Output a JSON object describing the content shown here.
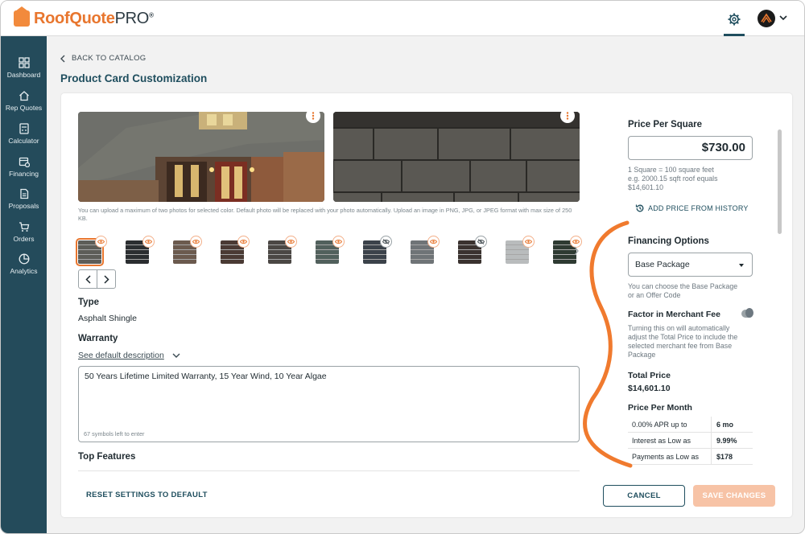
{
  "app": {
    "logo_main": "RoofQuote",
    "logo_pro": "PRO",
    "logo_reg": "®"
  },
  "sidebar": {
    "items": [
      {
        "label": "Dashboard",
        "icon": "dashboard-icon"
      },
      {
        "label": "Rep Quotes",
        "icon": "house-icon"
      },
      {
        "label": "Calculator",
        "icon": "calculator-icon"
      },
      {
        "label": "Financing",
        "icon": "calendar-money-icon"
      },
      {
        "label": "Proposals",
        "icon": "document-icon"
      },
      {
        "label": "Orders",
        "icon": "cart-icon"
      },
      {
        "label": "Analytics",
        "icon": "pie-chart-icon"
      }
    ]
  },
  "header": {
    "back_label": "BACK TO CATALOG",
    "title": "Product Card Customization"
  },
  "photos": {
    "note": "You can upload a maximum of two photos for selected color. Default photo will be replaced with your photo automatically. Upload an image in PNG, JPG, or JPEG format with max size of 250 KB."
  },
  "swatches": {
    "colors": [
      "#5d5d58",
      "#2b2e30",
      "#6b5a4e",
      "#4a3a34",
      "#4b4744",
      "#51605c",
      "#3b424a",
      "#6f7477",
      "#3a322f",
      "#b9bcbd",
      "#2e3a32"
    ],
    "visible": [
      true,
      true,
      true,
      true,
      true,
      true,
      false,
      true,
      false,
      true,
      true
    ],
    "selected_index": 0
  },
  "details": {
    "type_label": "Type",
    "type_value": "Asphalt Shingle",
    "warranty_label": "Warranty",
    "default_desc_link": "See default description",
    "warranty_text": "50 Years Lifetime Limited Warranty, 15 Year Wind, 10 Year Algae",
    "counter": "67 symbols left to enter",
    "top_features_label": "Top Features"
  },
  "pricing": {
    "pps_title": "Price Per Square",
    "pps_value": "$730.00",
    "pps_note_1": "1 Square = 100 square feet",
    "pps_note_2": "e.g. 2000.15 sqft roof equals",
    "pps_note_3": "$14,601.10",
    "history_link": "ADD PRICE FROM HISTORY",
    "financing_title": "Financing Options",
    "financing_selected": "Base Package",
    "financing_note_1": "You can choose the Base Package",
    "financing_note_2": "or an Offer Code",
    "merchant_fee_label": "Factor in Merchant Fee",
    "merchant_fee_note_1": "Turning this on will automatically",
    "merchant_fee_note_2": "adjust the Total Price to include the",
    "merchant_fee_note_3": "selected merchant fee from Base",
    "merchant_fee_note_4": "Package",
    "total_label": "Total Price",
    "total_value": "$14,601.10",
    "ppm_label": "Price Per Month",
    "ppm_rows": [
      {
        "k": "0.00% APR up to",
        "v": "6 mo"
      },
      {
        "k": "Interest as Low as",
        "v": "9.99%"
      },
      {
        "k": "Payments as Low as",
        "v": "$178"
      }
    ]
  },
  "footer": {
    "reset": "RESET SETTINGS TO DEFAULT",
    "cancel": "CANCEL",
    "save": "SAVE CHANGES"
  },
  "colors": {
    "sidebar": "#244b5b",
    "accent": "#e8762e",
    "primary_text": "#1f4e5e"
  }
}
